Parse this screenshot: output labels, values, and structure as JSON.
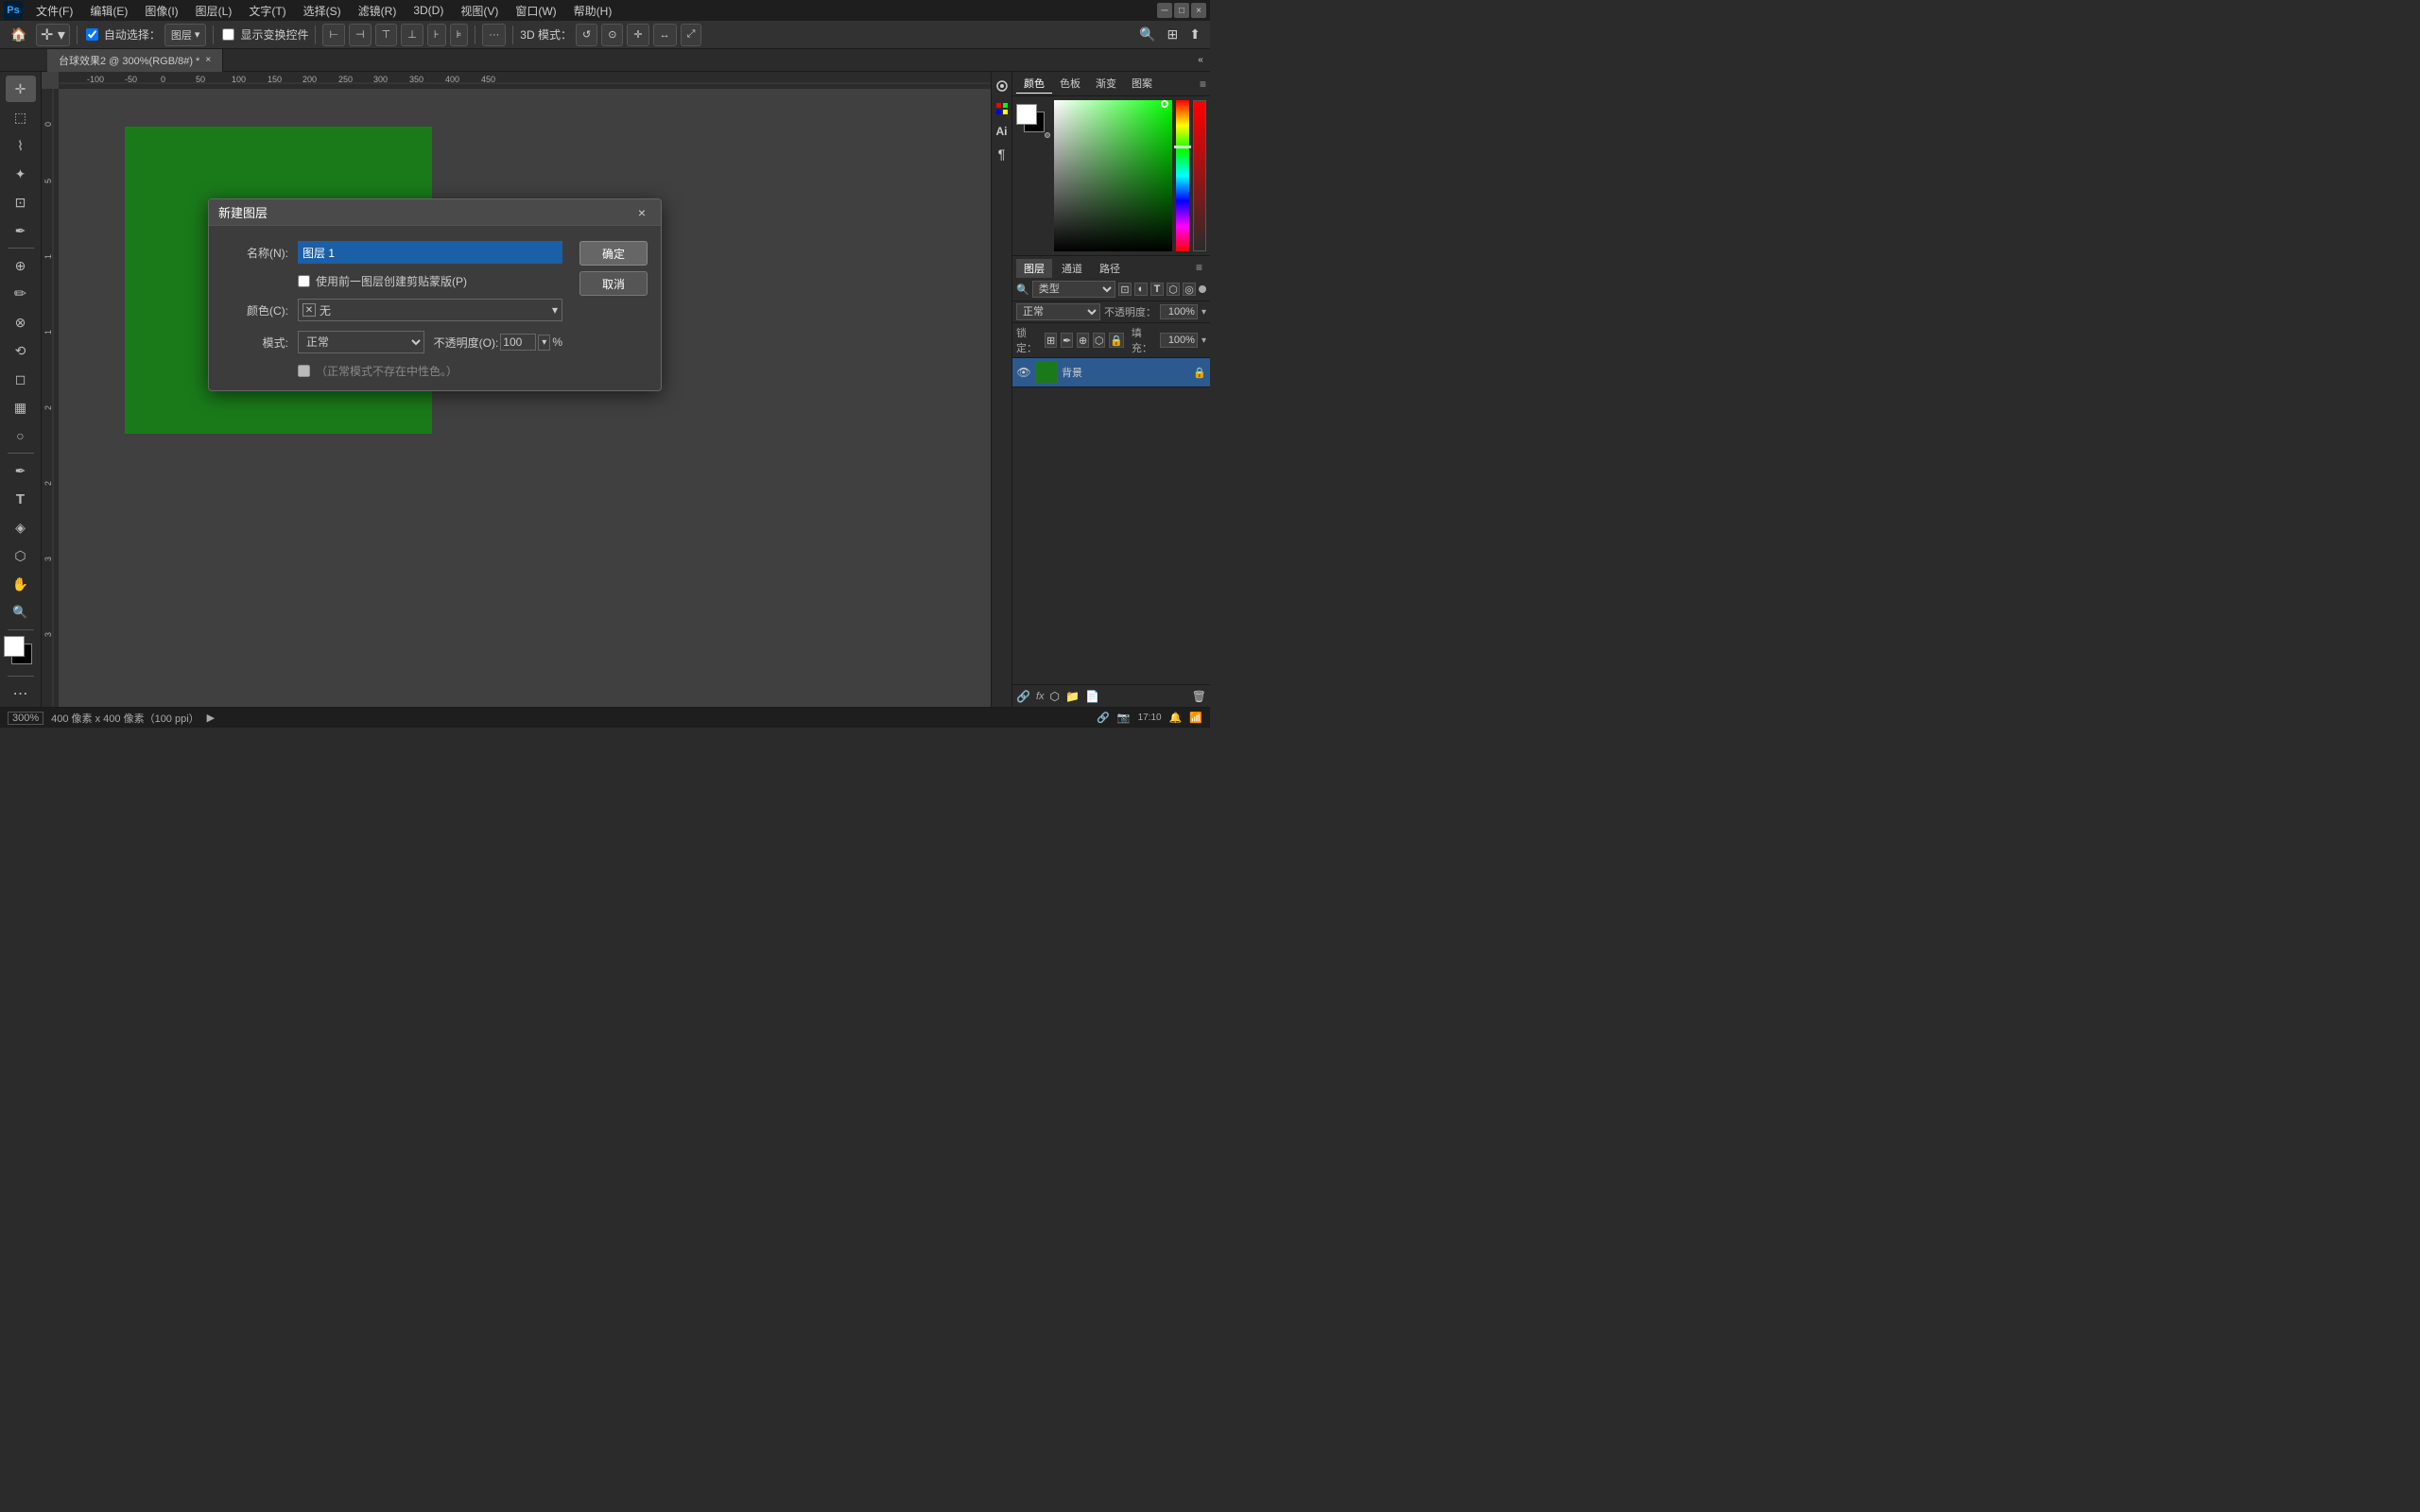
{
  "app": {
    "title": "Adobe Photoshop",
    "logo": "Ps"
  },
  "menu": {
    "items": [
      "文件(F)",
      "编辑(E)",
      "图像(I)",
      "图层(L)",
      "文字(T)",
      "选择(S)",
      "滤镜(R)",
      "3D(D)",
      "视图(V)",
      "窗口(W)",
      "帮助(H)"
    ]
  },
  "options_bar": {
    "auto_select_label": "自动选择：",
    "layer_dropdown": "图层",
    "transform_label": "显示变换控件",
    "mode_3d_label": "3D 模式：",
    "more_icon": "···"
  },
  "tab": {
    "doc_name": "台球效果2 @ 300%(RGB/8#) *",
    "close": "×"
  },
  "canvas": {
    "bg_color": "#404040",
    "green_color": "#1a7a1a",
    "zoom": "300%",
    "doc_info": "400 像素 x 400 像素（100 ppi）"
  },
  "ruler": {
    "unit": "px",
    "ticks_top": [
      "-100",
      "-50",
      "0",
      "50",
      "100",
      "150",
      "200",
      "250",
      "300",
      "350",
      "400",
      "450"
    ]
  },
  "dialog": {
    "title": "新建图层",
    "close": "×",
    "name_label": "名称(N):",
    "name_value": "图层 1",
    "use_prev_checkbox_label": "使用前一图层创建剪贴蒙版(P)",
    "use_prev_checked": false,
    "color_label": "颜色(C):",
    "color_value": "无",
    "color_icon": "✕",
    "mode_label": "模式:",
    "mode_value": "正常",
    "opacity_label": "不透明度(O):",
    "opacity_value": "100",
    "opacity_unit": "%",
    "neutral_checkbox_label": "（正常模式不存在中性色。）",
    "neutral_checked": false,
    "btn_ok": "确定",
    "btn_cancel": "取消"
  },
  "right_panel": {
    "color_tab": "颜色",
    "swatches_tab": "色板",
    "gradient_tab": "渐变",
    "pattern_tab": "图案"
  },
  "layers_panel": {
    "tabs": [
      "图层",
      "通道",
      "路径"
    ],
    "active_tab": "图层",
    "filter_label": "类型",
    "mode_label": "正常",
    "opacity_label": "不透明度：",
    "opacity_value": "100%",
    "lock_label": "锁定：",
    "fill_label": "填充：",
    "fill_value": "100%",
    "layers": [
      {
        "name": "背景",
        "visible": true,
        "thumb_color": "#1a7a1a",
        "locked": true
      }
    ]
  },
  "status_bar": {
    "zoom": "300%",
    "doc_size": "400 像素 x 400 像素（100 ppi）",
    "arrow": "▶"
  },
  "tools": {
    "left": [
      {
        "id": "move",
        "icon": "✛",
        "active": true
      },
      {
        "id": "select-rect",
        "icon": "⬚"
      },
      {
        "id": "lasso",
        "icon": "⌇"
      },
      {
        "id": "magic-wand",
        "icon": "✦"
      },
      {
        "id": "crop",
        "icon": "⊞"
      },
      {
        "id": "eyedropper",
        "icon": "✒"
      },
      {
        "sep": true
      },
      {
        "id": "spot-heal",
        "icon": "⊕"
      },
      {
        "id": "brush",
        "icon": "✏"
      },
      {
        "id": "clone",
        "icon": "✇"
      },
      {
        "id": "history",
        "icon": "⌛"
      },
      {
        "id": "eraser",
        "icon": "◻"
      },
      {
        "id": "gradient",
        "icon": "▦"
      },
      {
        "id": "dodge",
        "icon": "○"
      },
      {
        "sep": true
      },
      {
        "id": "pen",
        "icon": "✒"
      },
      {
        "id": "text",
        "icon": "T"
      },
      {
        "id": "path-select",
        "icon": "◈"
      },
      {
        "id": "shape",
        "icon": "⬡"
      },
      {
        "id": "hand",
        "icon": "✋"
      },
      {
        "id": "zoom",
        "icon": "🔍"
      },
      {
        "sep": true
      },
      {
        "id": "more-tools",
        "icon": "⋯"
      }
    ]
  }
}
